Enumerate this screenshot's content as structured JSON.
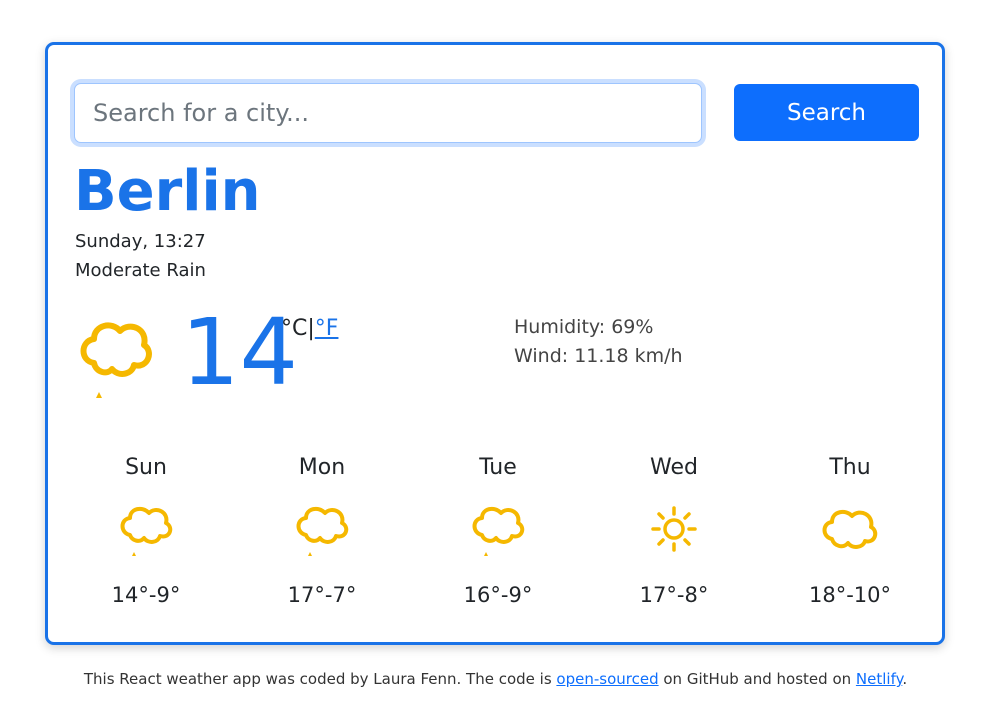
{
  "search": {
    "placeholder": "Search for a city...",
    "button_label": "Search"
  },
  "current": {
    "city": "Berlin",
    "date": "Sunday, 13:27",
    "description": "Moderate Rain",
    "icon": "cloud-rain-icon",
    "temperature": "14",
    "unit_celsius": "°C",
    "unit_separator": " | ",
    "unit_fahrenheit": "°F",
    "humidity": "Humidity: 69%",
    "wind": "Wind: 11.18 km/h"
  },
  "forecast": [
    {
      "day": "Sun",
      "icon": "cloud-rain-icon",
      "temps": "14°-9°"
    },
    {
      "day": "Mon",
      "icon": "cloud-rain-icon",
      "temps": "17°-7°"
    },
    {
      "day": "Tue",
      "icon": "cloud-rain-icon",
      "temps": "16°-9°"
    },
    {
      "day": "Wed",
      "icon": "sun-icon",
      "temps": "17°-8°"
    },
    {
      "day": "Thu",
      "icon": "cloud-icon",
      "temps": "18°-10°"
    }
  ],
  "footer": {
    "text_before": "This React weather app was coded by Laura Fenn. The code is ",
    "link1": "open-sourced",
    "text_middle": " on GitHub and hosted on ",
    "link2": "Netlify",
    "text_after": "."
  },
  "colors": {
    "accent": "#1a73e8",
    "button": "#0d6efd",
    "icon": "#f5b800"
  }
}
